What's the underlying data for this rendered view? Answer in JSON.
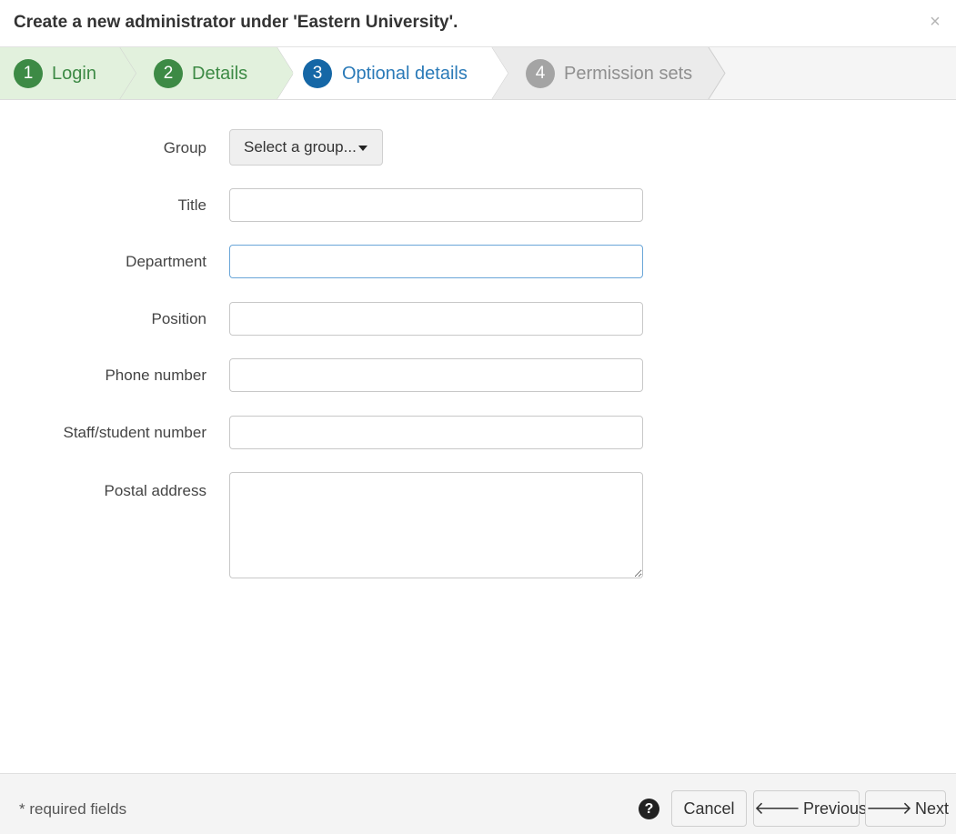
{
  "header": {
    "title": "Create a new administrator under 'Eastern University'.",
    "close_icon": "close-icon",
    "close_glyph": "×"
  },
  "steps": [
    {
      "number": "1",
      "label": "Login",
      "state": "complete"
    },
    {
      "number": "2",
      "label": "Details",
      "state": "complete"
    },
    {
      "number": "3",
      "label": "Optional details",
      "state": "active"
    },
    {
      "number": "4",
      "label": "Permission sets",
      "state": "upcoming"
    }
  ],
  "colors": {
    "complete": "#3d8a45",
    "complete_bg": "#e2f1dd",
    "active": "#1567a6",
    "upcoming": "#a4a4a4",
    "upcoming_bg": "#ebebeb"
  },
  "form": {
    "group": {
      "label": "Group",
      "button_label": "Select a group..."
    },
    "title": {
      "label": "Title",
      "value": ""
    },
    "department": {
      "label": "Department",
      "value": ""
    },
    "position": {
      "label": "Position",
      "value": ""
    },
    "phone": {
      "label": "Phone number",
      "value": ""
    },
    "staff_number": {
      "label": "Staff/student number",
      "value": ""
    },
    "postal_address": {
      "label": "Postal address",
      "value": ""
    }
  },
  "footer": {
    "required_note": "* required fields",
    "help_glyph": "?",
    "cancel_label": "Cancel",
    "previous_label": "Previous",
    "next_label": "Next",
    "left_arrow": "🡐",
    "right_arrow": "🡒"
  }
}
